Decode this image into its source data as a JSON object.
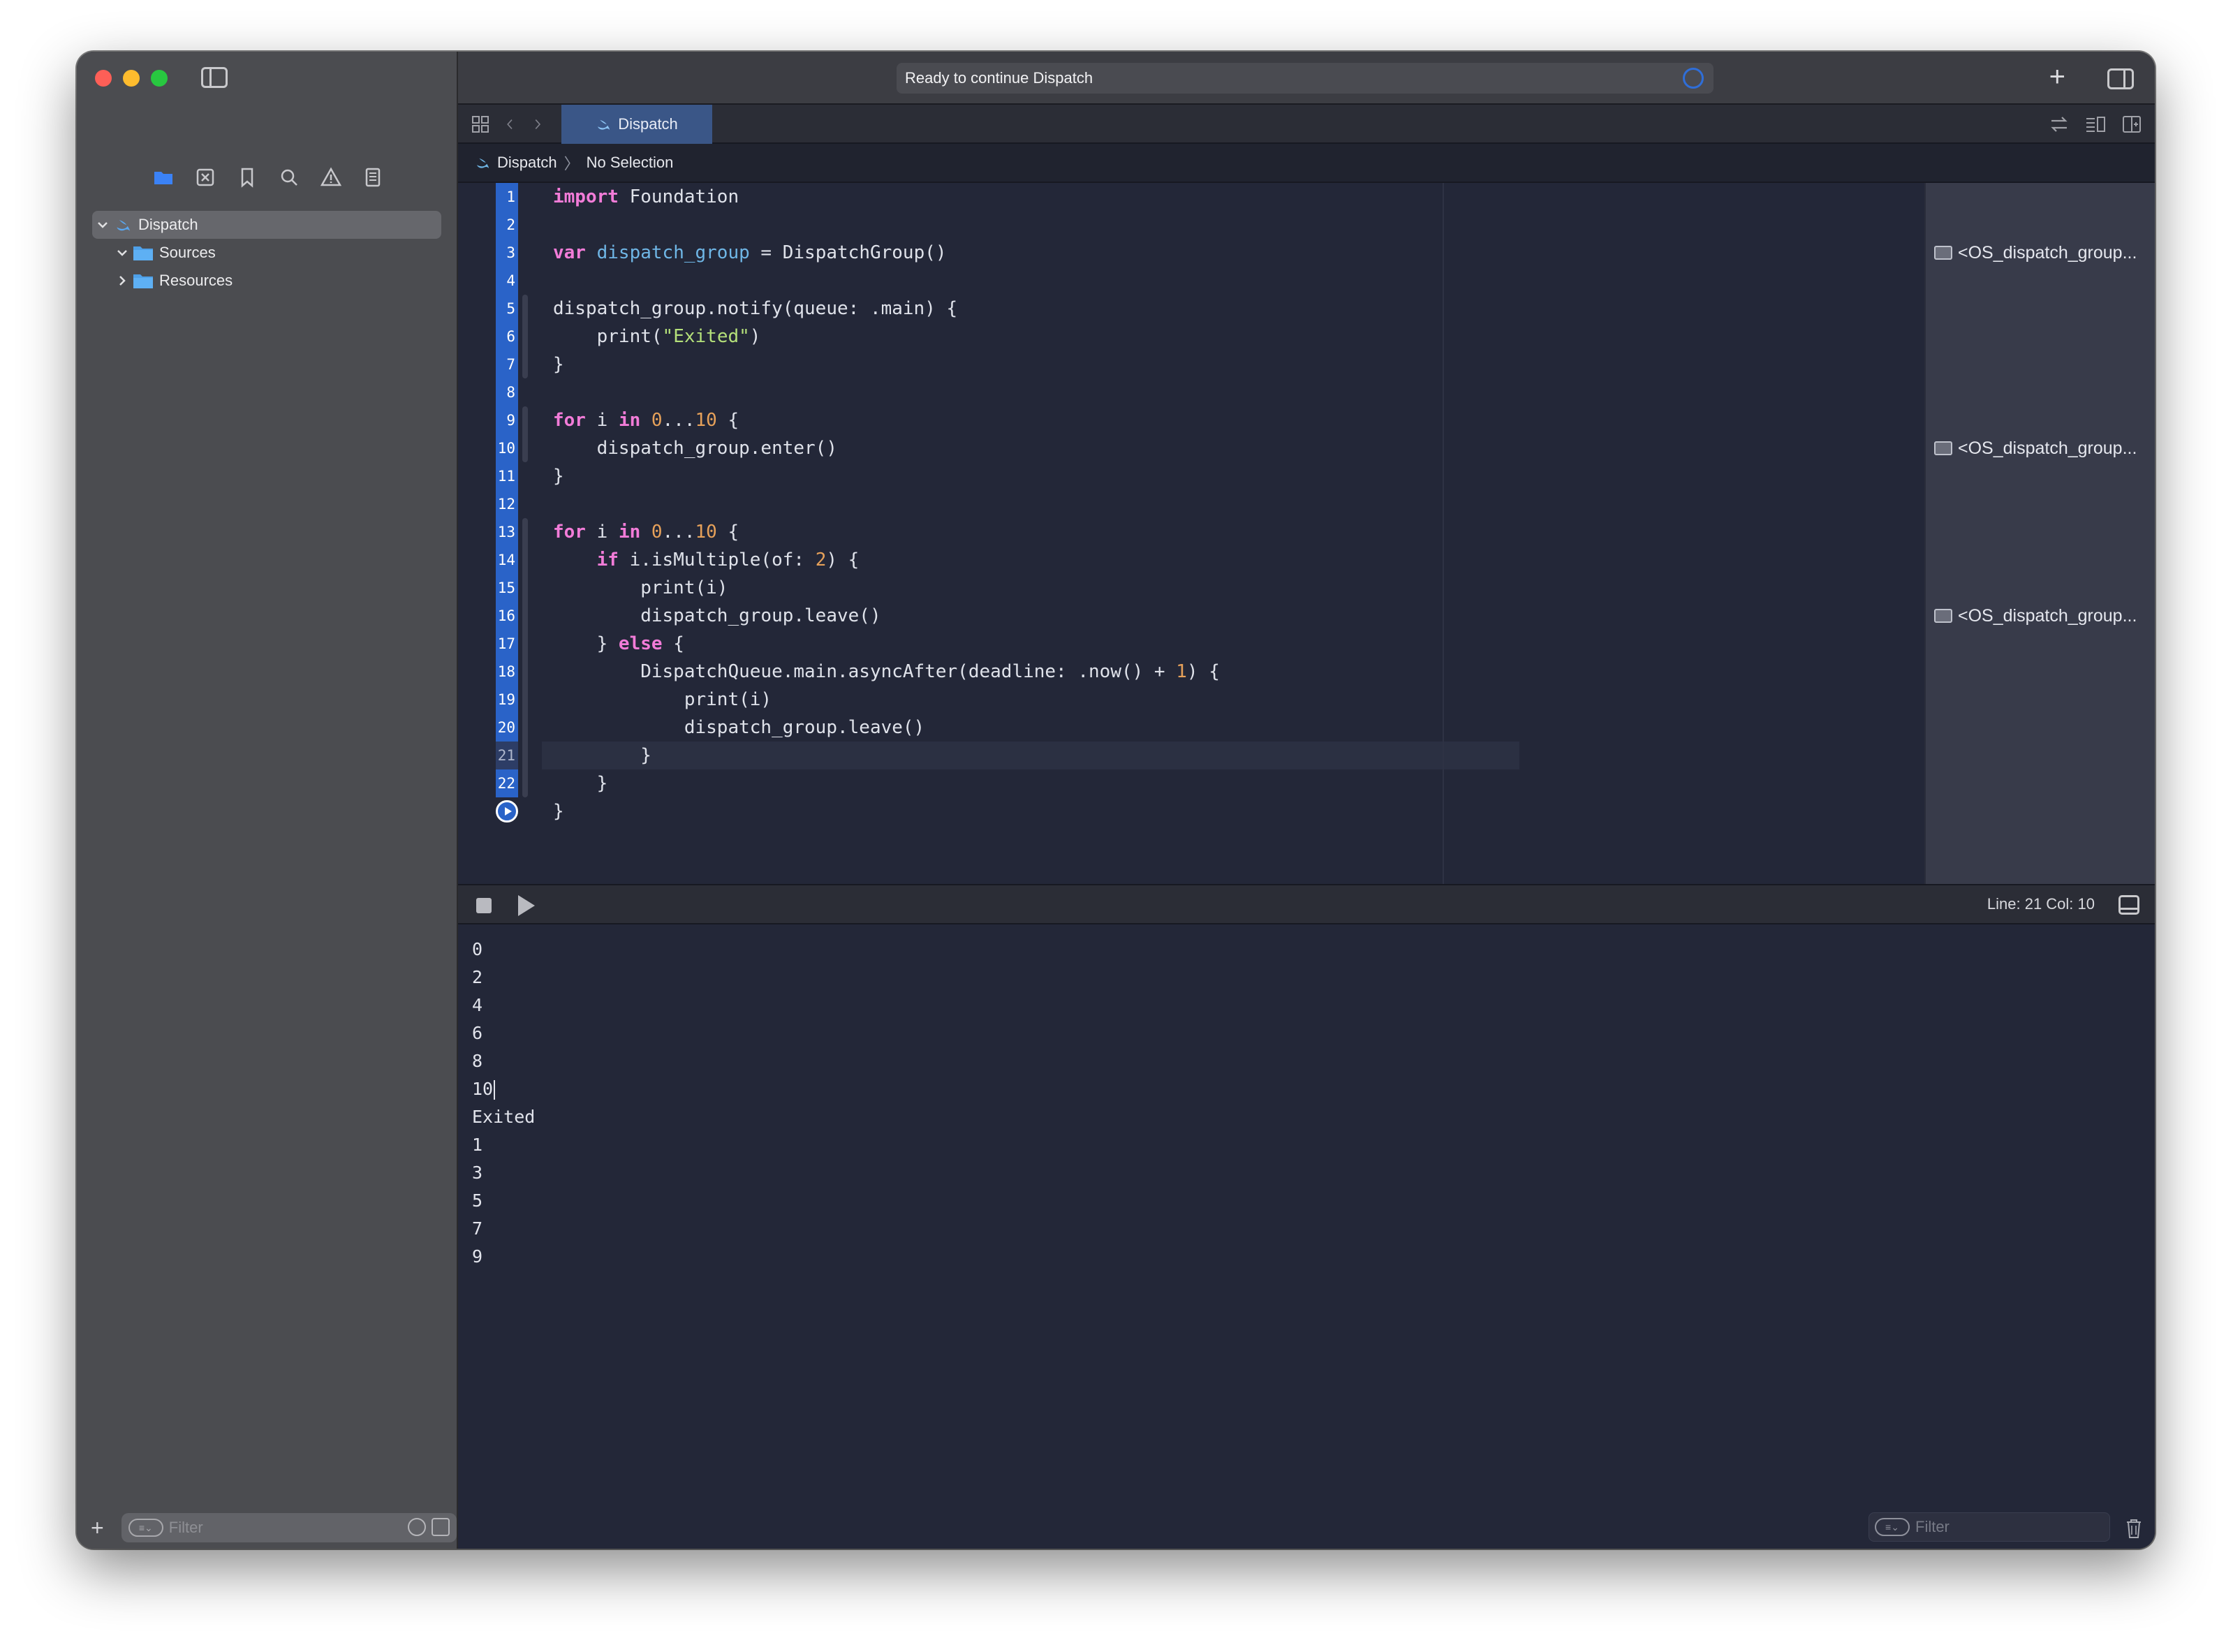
{
  "window": {
    "status_text": "Ready to continue Dispatch"
  },
  "sidebar": {
    "nav_icons": [
      "folder-icon",
      "source-control-icon",
      "bookmark-icon",
      "search-icon",
      "warning-icon",
      "report-icon"
    ],
    "tree": [
      {
        "label": "Dispatch",
        "icon": "swift-icon",
        "expanded": true,
        "selected": true,
        "level": 0
      },
      {
        "label": "Sources",
        "icon": "folder-icon",
        "expanded": true,
        "selected": false,
        "level": 1
      },
      {
        "label": "Resources",
        "icon": "folder-icon",
        "expanded": false,
        "selected": false,
        "level": 1
      }
    ],
    "filter_placeholder": "Filter"
  },
  "tabs": {
    "active_label": "Dispatch"
  },
  "jumpbar": {
    "file": "Dispatch",
    "selection": "No Selection"
  },
  "editor": {
    "line_numbers": [
      "1",
      "2",
      "3",
      "4",
      "5",
      "6",
      "7",
      "8",
      "9",
      "10",
      "11",
      "12",
      "13",
      "14",
      "15",
      "16",
      "17",
      "18",
      "19",
      "20",
      "21",
      "22"
    ],
    "current_line": 21,
    "results": [
      {
        "line": 3,
        "text": "<OS_dispatch_group..."
      },
      {
        "line": 10,
        "text": "<OS_dispatch_group..."
      },
      {
        "line": 16,
        "text": "<OS_dispatch_group..."
      }
    ]
  },
  "debug": {
    "position": "Line: 21  Col: 10"
  },
  "console": {
    "lines": [
      "0",
      "2",
      "4",
      "6",
      "8",
      "10",
      "Exited",
      "1",
      "3",
      "5",
      "7",
      "9"
    ],
    "filter_placeholder": "Filter"
  },
  "colors": {
    "accent": "#2a63c8",
    "editor_bg": "#232738",
    "sidebar_bg": "#4b4c50",
    "keyword": "#f27cd8",
    "number": "#e6a15a",
    "string": "#b4e07a"
  }
}
